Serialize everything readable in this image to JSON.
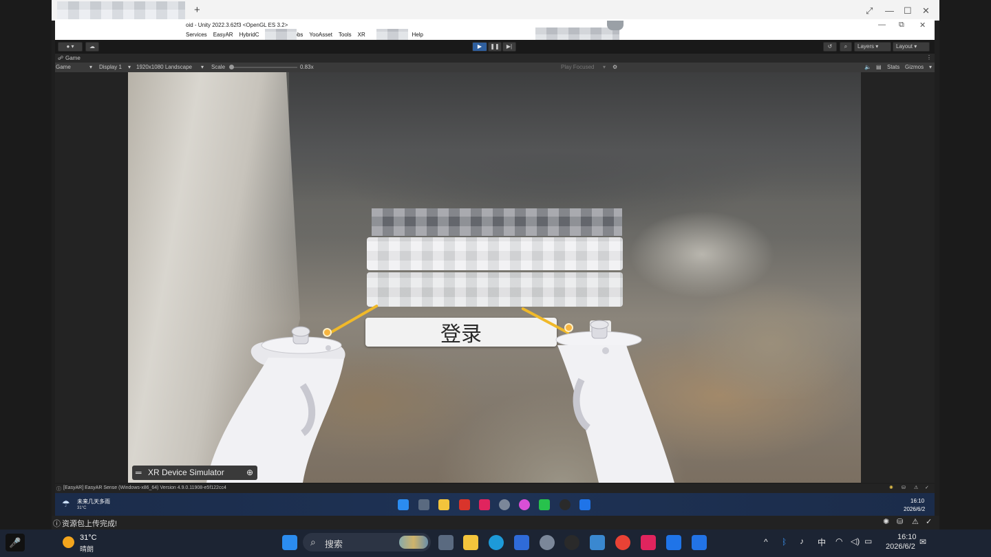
{
  "outer_window": {
    "new_tab_label": "+",
    "controls": [
      "⤢",
      "—",
      "☐",
      "✕"
    ]
  },
  "unity": {
    "window_title": "oid - Unity 2022.3.62f3 <OpenGL ES 3.2>",
    "window_controls": [
      "—",
      "⧉",
      "✕"
    ],
    "menu": [
      "Services",
      "EasyAR",
      "HybridC",
      "Jobs",
      "YooAsset",
      "Tools",
      "XR",
      "w",
      "Help"
    ],
    "toolbar": {
      "account_label": "",
      "layers_label": "Layers",
      "layout_label": "Layout"
    },
    "game_tab_label": "Game",
    "game_bar": {
      "view_mode": "Game",
      "display": "Display 1",
      "resolution": "1920x1080 Landscape",
      "scale_label": "Scale",
      "scale_value": "0.83x",
      "play_mode": "Play Focused",
      "stats_label": "Stats",
      "gizmos_label": "Gizmos"
    },
    "scale_level": 0.0,
    "xr_simulator_label": "XR Device Simulator",
    "login_button_label": "登录",
    "console_message": "[EasyAR] EasyAR Sense (Windows-x86_64) Version 4.9.0.11908-e5f122cc4"
  },
  "inner_taskbar": {
    "weather_title": "未来几天多雨",
    "weather_temp": "31°C",
    "time": "16:10",
    "date": "2026/6/2"
  },
  "outer_status": {
    "message": "资源包上传完成!"
  },
  "outer_taskbar": {
    "weather_temp": "31°C",
    "weather_desc": "晴朗",
    "search_placeholder": "搜索",
    "ime_label": "中",
    "time": "16:10",
    "date": "2026/6/2"
  },
  "colors": {
    "ray": "#f0b92a",
    "unity_dark": "#191919",
    "taskbar": "#1c2433"
  }
}
